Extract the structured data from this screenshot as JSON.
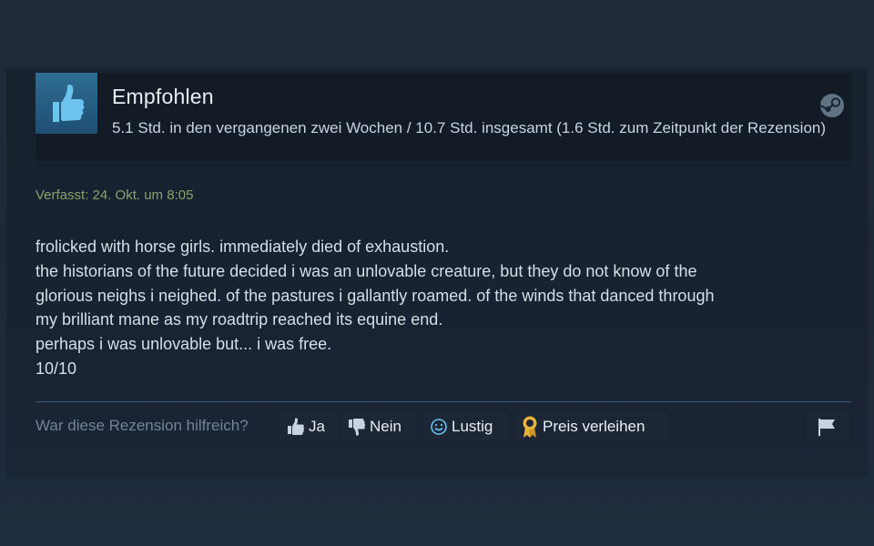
{
  "review": {
    "recommendation": "Empfohlen",
    "playtime": "5.1 Std. in den vergangenen zwei Wochen / 10.7 Std. insgesamt (1.6 Std. zum Zeitpunkt der Rezension)",
    "posted": "Verfasst: 24. Okt. um 8:05",
    "body_lines": [
      "frolicked with horse girls. immediately died of exhaustion.",
      "the historians of the future decided i was an unlovable creature, but they do not know of the",
      "glorious neighs i neighed. of the pastures i gallantly roamed. of the winds that danced through",
      "my brilliant mane as my roadtrip reached its equine end.",
      "perhaps i was unlovable but... i was free.",
      "10/10"
    ]
  },
  "feedback": {
    "question": "War diese Rezension hilfreich?",
    "yes_label": "Ja",
    "no_label": "Nein",
    "funny_label": "Lustig",
    "award_label": "Preis verleihen"
  },
  "icons": {
    "thumb": "thumbs-up-icon",
    "steam": "steam-icon",
    "flag": "flag-icon",
    "award": "award-ribbon-icon",
    "smiley": "smiley-icon"
  },
  "colors": {
    "thumb_bg": "#2f6d93",
    "posted_text": "#8aa26a",
    "award_gold": "#e7b43a"
  }
}
